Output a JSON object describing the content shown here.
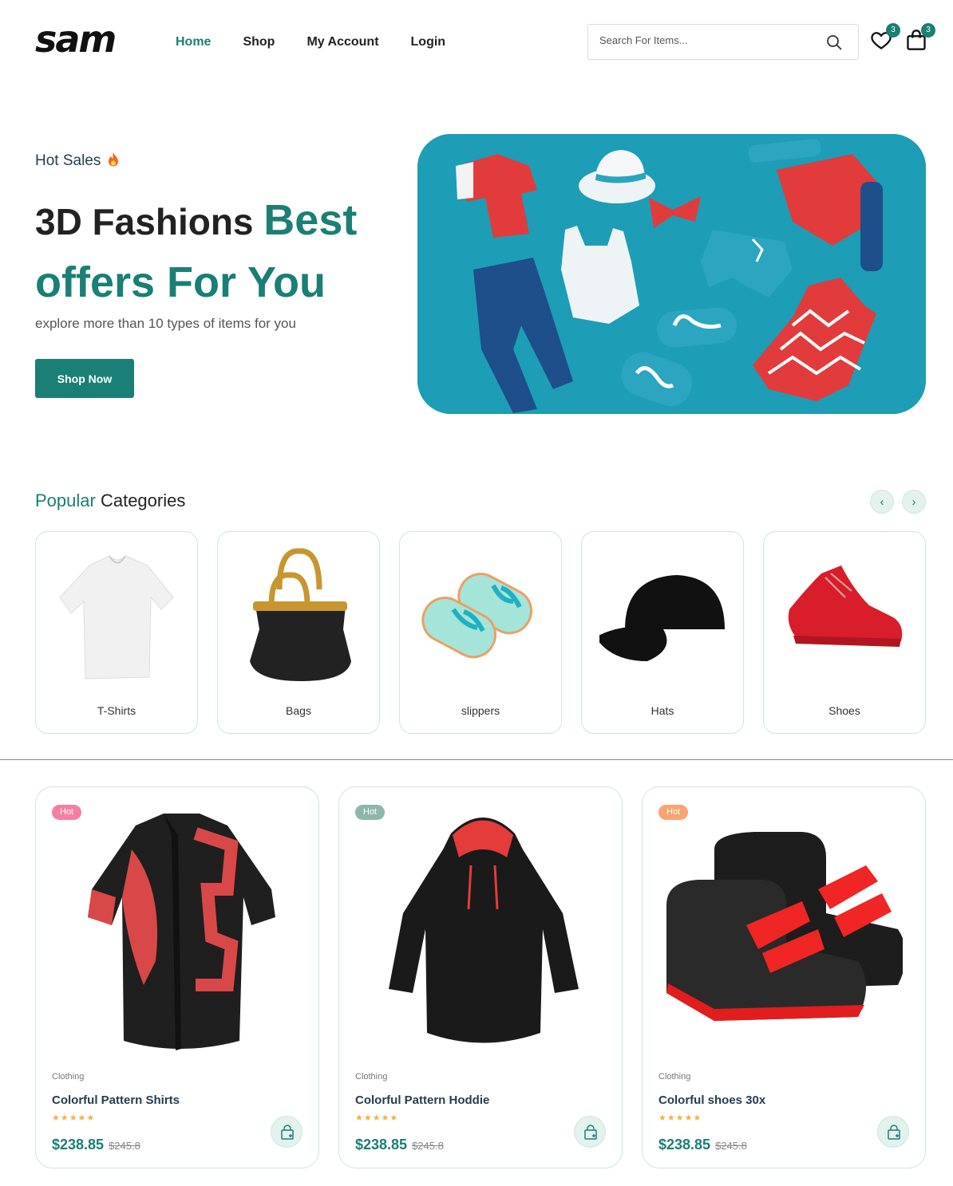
{
  "brand": {
    "logo": "sam"
  },
  "nav": {
    "items": [
      "Home",
      "Shop",
      "My Account",
      "Login"
    ]
  },
  "search": {
    "placeholder": "Search For Items..."
  },
  "wishlist": {
    "count": "3"
  },
  "cart": {
    "count": "3"
  },
  "hero": {
    "tag": "Hot Sales",
    "title_plain": "3D Fashions ",
    "title_highlight_1": "Best",
    "title_highlight_2": "offers For You",
    "subtitle": "explore more than 10 types of items for you",
    "button": "Shop Now"
  },
  "categories": {
    "title_highlight": "Popular",
    "title_rest": " Categories",
    "items": [
      "T-Shirts",
      "Bags",
      "slippers",
      "Hats",
      "Shoes"
    ]
  },
  "products": [
    {
      "tag": "Hot",
      "tag_color": "#f67ea3",
      "category": "Clothing",
      "name": "Colorful Pattern Shirts",
      "stars": "★★★★★",
      "price": "$238.85",
      "old_price": "$245.8"
    },
    {
      "tag": "Hot",
      "tag_color": "#8fb6ab",
      "category": "Clothing",
      "name": "Colorful Pattern Hoddie",
      "stars": "★★★★★",
      "price": "$238.85",
      "old_price": "$245.8"
    },
    {
      "tag": "Hot",
      "tag_color": "#f7a470",
      "category": "Clothing",
      "name": "Colorful shoes 30x",
      "stars": "★★★★★",
      "price": "$238.85",
      "old_price": "$245.8"
    }
  ],
  "colors": {
    "accent": "#1a7f74",
    "hero_bg": "#1d9db6"
  }
}
